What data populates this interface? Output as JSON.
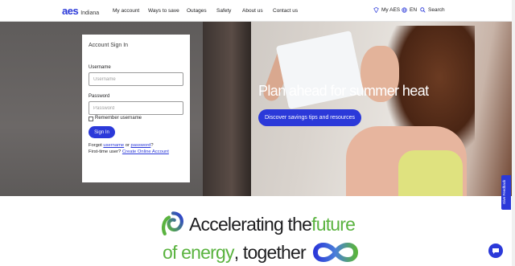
{
  "brand": {
    "logo_text": "aes",
    "logo_sub": "Indiana"
  },
  "nav": [
    "My account",
    "Ways to save",
    "Outages",
    "Safety",
    "About us",
    "Contact us"
  ],
  "util": {
    "my_aes": "My AES",
    "language": "EN",
    "search": "Search"
  },
  "hero": {
    "title": "Plan ahead for summer heat",
    "cta": "Discover savings tips and resources"
  },
  "signin": {
    "title": "Account Sign In",
    "username_label": "Username",
    "username_placeholder": "Username",
    "password_label": "Password",
    "password_placeholder": "Password",
    "remember_label": "Remember username",
    "button": "Sign In",
    "forgot_prefix": "Forgot ",
    "forgot_username": "username",
    "forgot_or": " or ",
    "forgot_password": "password",
    "forgot_suffix": "?",
    "first_time": "First-time user? ",
    "create_account": "Create Online Account"
  },
  "feedback_label": "Give Feedback",
  "tagline": {
    "line1_a": "Accelerating the ",
    "line1_b": "future",
    "line2_a": "of energy",
    "line2_b": ", together"
  },
  "colors": {
    "brand_blue": "#2b39d9",
    "accent_green": "#5ab33f"
  }
}
